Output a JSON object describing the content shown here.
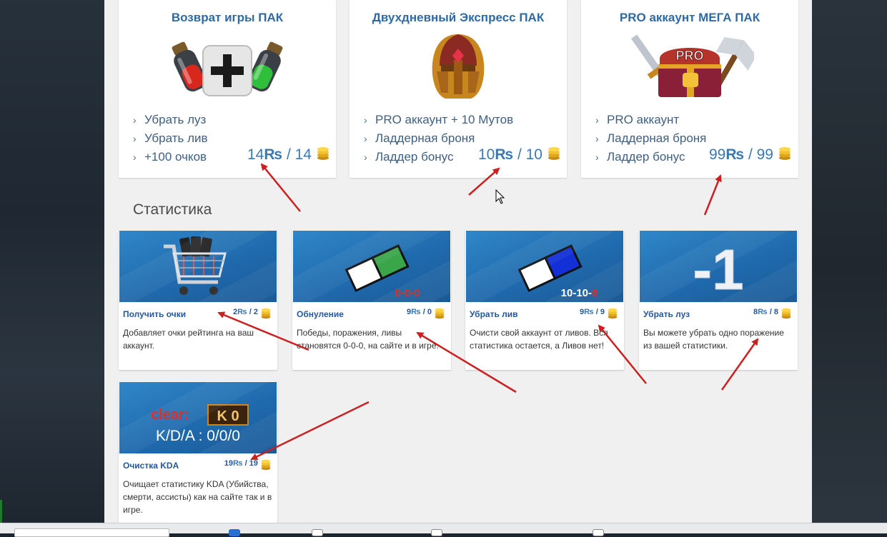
{
  "packs": [
    {
      "title": "Возврат игры ПАК",
      "items": [
        "Убрать луз",
        "Убрать лив",
        "+100 очков"
      ],
      "price_r": "14",
      "price_coins": "14",
      "image": "potions-plus-icon"
    },
    {
      "title": "Двухдневный Экспресс ПАК",
      "items": [
        "PRO аккаунт + 10 Мутов",
        "Ладдерная броня",
        "Ладдер бонус"
      ],
      "price_r": "10",
      "price_coins": "10",
      "image": "helmet-icon"
    },
    {
      "title": "PRO аккаунт МЕГА ПАК",
      "items": [
        "PRO аккаунт",
        "Ладдерная броня",
        "Ладдер бонус"
      ],
      "price_r": "99",
      "price_coins": "99",
      "image": "pro-chest-icon"
    }
  ],
  "currency_symbol": "₨",
  "price_separator": "/",
  "stats": {
    "title": "Статистика",
    "cards": [
      {
        "name": "Получить очки",
        "price_r": "2",
        "price_coins": "2",
        "description": "Добавляет очки рейтинга на ваш аккаунт.",
        "image": "cart-icon",
        "overlay": ""
      },
      {
        "name": "Обнуление",
        "price_r": "9",
        "price_coins": "0",
        "description": "Победы, поражения, ливы становятся 0-0-0, на сайте и в игре.",
        "image": "green-eraser-icon",
        "overlay": "0-0-0"
      },
      {
        "name": "Убрать лив",
        "price_r": "9",
        "price_coins": "9",
        "description": "Очисти свой аккаунт от ливов. Вся статистика остается, а Ливов нет!",
        "image": "blue-eraser-icon",
        "overlay": "10-10-",
        "overlay_red": "0"
      },
      {
        "name": "Убрать луз",
        "price_r": "8",
        "price_coins": "8",
        "description": "Вы можете убрать одно поражение из вашей статистики.",
        "image": "minus-one-icon",
        "overlay": "-1"
      },
      {
        "name": "Очистка KDA",
        "price_r": "19",
        "price_coins": "19",
        "description": "Очищает статистику KDA (Убийства, смерти, ассисты) как на сайте так и в игре.",
        "image": "kda-icon",
        "overlay": "clear:",
        "overlay_box": "K 0",
        "overlay_sub": "K/D/A : 0/0/0"
      }
    ]
  },
  "colors": {
    "accent": "#2f6aa3",
    "card_bg": "#1f6aad",
    "arrow": "#cc1f1f",
    "content_bg": "#f0f0f0"
  }
}
